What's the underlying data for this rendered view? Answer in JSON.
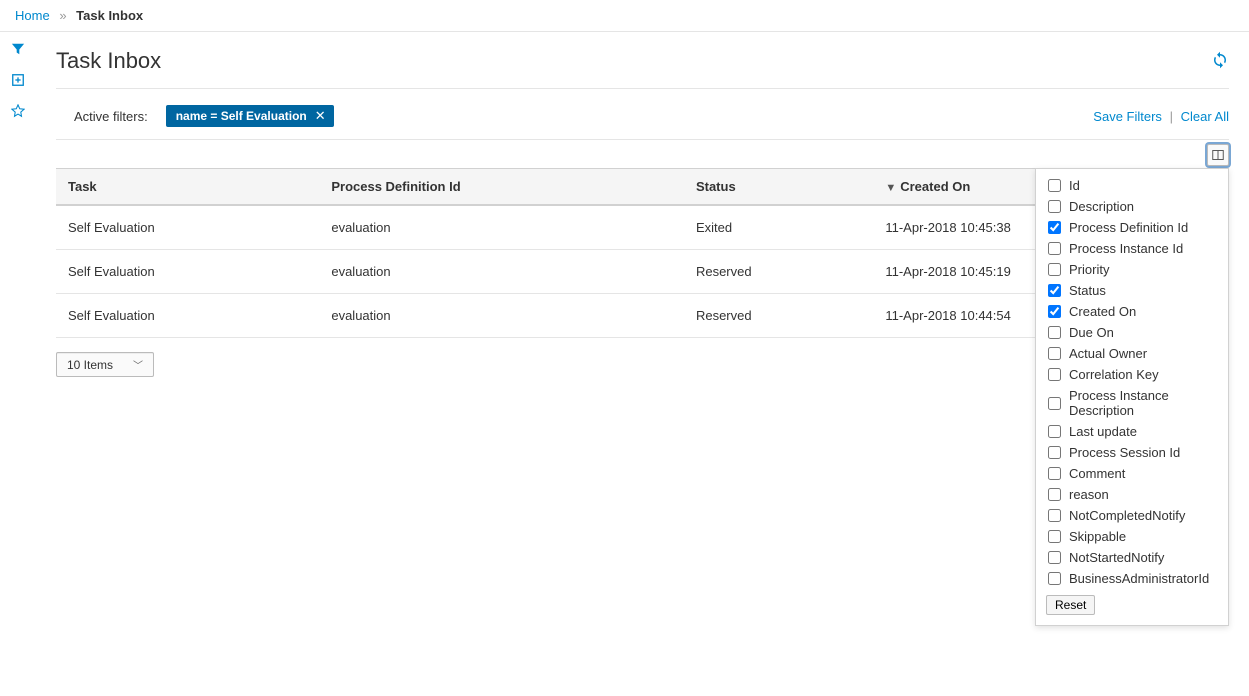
{
  "breadcrumb": {
    "home": "Home",
    "sep": "»",
    "current": "Task Inbox"
  },
  "page": {
    "title": "Task Inbox"
  },
  "filters": {
    "label": "Active filters:",
    "chip": "name = Self Evaluation",
    "save": "Save Filters",
    "clear": "Clear All"
  },
  "table": {
    "headers": {
      "task": "Task",
      "procDef": "Process Definition Id",
      "status": "Status",
      "created": "Created On"
    },
    "rows": [
      {
        "task": "Self Evaluation",
        "procDef": "evaluation",
        "status": "Exited",
        "created": "11-Apr-2018 10:45:38"
      },
      {
        "task": "Self Evaluation",
        "procDef": "evaluation",
        "status": "Reserved",
        "created": "11-Apr-2018 10:45:19"
      },
      {
        "task": "Self Evaluation",
        "procDef": "evaluation",
        "status": "Reserved",
        "created": "11-Apr-2018 10:44:54"
      }
    ]
  },
  "pagination": {
    "items": "10 Items"
  },
  "columnPicker": {
    "reset": "Reset",
    "options": [
      {
        "label": "Id",
        "checked": false
      },
      {
        "label": "Description",
        "checked": false
      },
      {
        "label": "Process Definition Id",
        "checked": true
      },
      {
        "label": "Process Instance Id",
        "checked": false
      },
      {
        "label": "Priority",
        "checked": false
      },
      {
        "label": "Status",
        "checked": true
      },
      {
        "label": "Created On",
        "checked": true
      },
      {
        "label": "Due On",
        "checked": false
      },
      {
        "label": "Actual Owner",
        "checked": false
      },
      {
        "label": "Correlation Key",
        "checked": false
      },
      {
        "label": "Process Instance Description",
        "checked": false
      },
      {
        "label": "Last update",
        "checked": false
      },
      {
        "label": "Process Session Id",
        "checked": false
      },
      {
        "label": "Comment",
        "checked": false
      },
      {
        "label": "reason",
        "checked": false
      },
      {
        "label": "NotCompletedNotify",
        "checked": false
      },
      {
        "label": "Skippable",
        "checked": false
      },
      {
        "label": "NotStartedNotify",
        "checked": false
      },
      {
        "label": "BusinessAdministratorId",
        "checked": false
      }
    ]
  }
}
